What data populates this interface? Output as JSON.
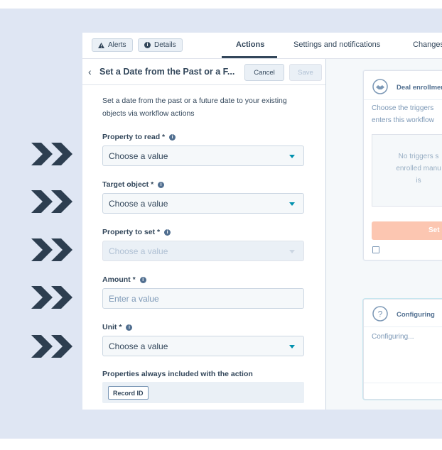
{
  "tabbar": {
    "alerts_label": "Alerts",
    "details_label": "Details",
    "tabs": [
      "Actions",
      "Settings and notifications",
      "Changes"
    ]
  },
  "panel": {
    "title": "Set a Date from the Past or a F...",
    "cancel_label": "Cancel",
    "save_label": "Save",
    "description": "Set a date from the past or a future date to your existing objects via workflow actions",
    "fields": [
      {
        "label": "Property to read *",
        "value": "Choose a value"
      },
      {
        "label": "Target object *",
        "value": "Choose a value"
      },
      {
        "label": "Property to set *",
        "value": "Choose a value"
      },
      {
        "label": "Amount *",
        "placeholder": "Enter a value"
      },
      {
        "label": "Unit *",
        "value": "Choose a value"
      }
    ],
    "always_included_label": "Properties always included with the action",
    "always_included_tag": "Record ID"
  },
  "canvas": {
    "trigger_card": {
      "title": "Deal enrollmen",
      "body_line1": "Choose the triggers",
      "body_line2": "enters this workflow",
      "empty_line1": "No triggers s",
      "empty_line2": "enrolled manu",
      "empty_line3": "is",
      "button_label": "Set"
    },
    "config_card": {
      "title": "Configuring",
      "body": "Configuring..."
    }
  },
  "colors": {
    "chevron": "#2d3e50",
    "accent": "#0091ae",
    "background": "#dfe6f3",
    "orange": "#fcc6b1"
  }
}
